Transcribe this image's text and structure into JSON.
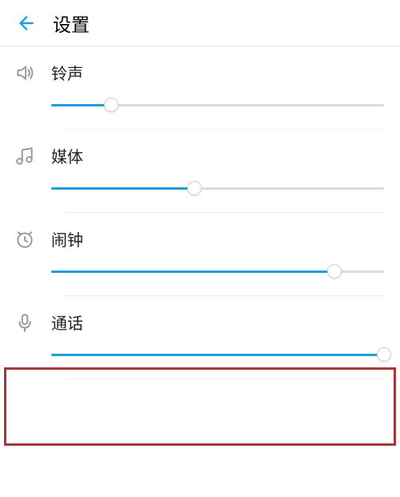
{
  "header": {
    "title": "设置"
  },
  "sections": [
    {
      "label": "铃声",
      "value": 18
    },
    {
      "label": "媒体",
      "value": 43
    },
    {
      "label": "闹钟",
      "value": 85
    },
    {
      "label": "通话",
      "value": 100
    }
  ],
  "colors": {
    "accent": "#1e9de0",
    "highlight": "#a63838"
  }
}
